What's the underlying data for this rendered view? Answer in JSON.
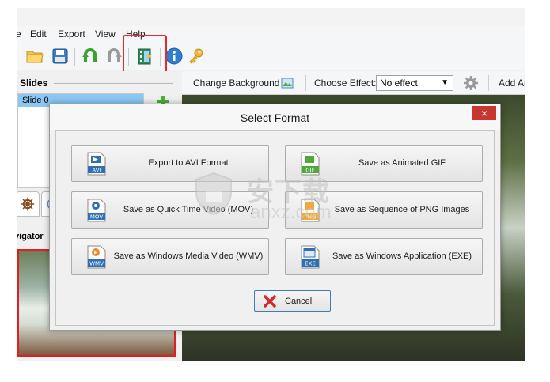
{
  "menu": {
    "fragment": "e",
    "items": [
      "Edit",
      "Export",
      "View",
      "Help"
    ]
  },
  "toolbar": {
    "icons": [
      "open-folder-icon",
      "save-icon",
      "undo-icon",
      "redo-icon",
      "export-video-icon",
      "info-icon",
      "key-icon"
    ]
  },
  "slides": {
    "title": "Slides",
    "items": [
      {
        "label": "Slide 0"
      }
    ]
  },
  "navigator": {
    "label": "vigator"
  },
  "header": {
    "change_background": "Change Background",
    "choose_effect_label": "Choose Effect:",
    "effect_value": "No effect",
    "add_label": "Add An"
  },
  "dialog": {
    "title": "Select Format",
    "close": "×",
    "buttons": [
      {
        "label": "Export to AVI Format",
        "badge": "AVI"
      },
      {
        "label": "Save as Animated GIF",
        "badge": "GIF"
      },
      {
        "label": "Save as Quick Time Video (MOV)",
        "badge": "MOV"
      },
      {
        "label": "Save as Sequence of PNG Images",
        "badge": "PNG"
      },
      {
        "label": "Save as Windows Media Video (WMV)",
        "badge": "WMV"
      },
      {
        "label": "Save as Windows Application (EXE)",
        "badge": "EXE"
      }
    ],
    "cancel": "Cancel"
  },
  "watermark": {
    "big": "安下载",
    "small": "anxz.com"
  },
  "colors": {
    "highlight": "#e8282c",
    "selection": "#8cc7f3",
    "close": "#c7372f"
  }
}
